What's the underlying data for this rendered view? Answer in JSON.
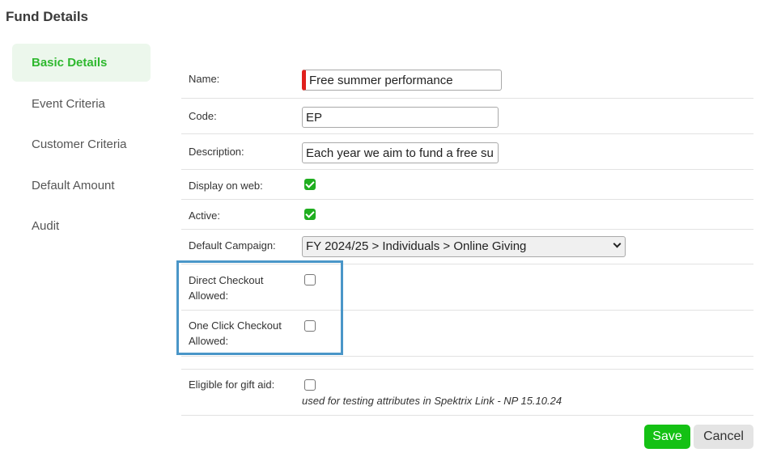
{
  "page_title": "Fund Details",
  "sidenav": {
    "items": [
      {
        "label": "Basic Details"
      },
      {
        "label": "Event Criteria"
      },
      {
        "label": "Customer Criteria"
      },
      {
        "label": "Default Amount"
      },
      {
        "label": "Audit"
      }
    ]
  },
  "form": {
    "name": {
      "label": "Name:",
      "value": "Free summer performance"
    },
    "code": {
      "label": "Code:",
      "value": "EP"
    },
    "description": {
      "label": "Description:",
      "value": "Each year we aim to fund a free su"
    },
    "display_on_web": {
      "label": "Display on web:",
      "checked": true
    },
    "active": {
      "label": "Active:",
      "checked": true
    },
    "default_campaign": {
      "label": "Default Campaign:",
      "value": "FY 2024/25 > Individuals > Online Giving"
    },
    "direct_checkout": {
      "label_line1": "Direct Checkout",
      "label_line2": "Allowed:",
      "checked": false
    },
    "one_click_checkout": {
      "label_line1": "One Click Checkout",
      "label_line2": "Allowed:",
      "checked": false
    },
    "gift_aid": {
      "label": "Eligible for gift aid:",
      "checked": false,
      "note": "used for testing attributes in Spektrix Link - NP 15.10.24"
    }
  },
  "buttons": {
    "save": "Save",
    "cancel": "Cancel"
  },
  "colors": {
    "accent_green": "#1fae1f",
    "save_button": "#14c114",
    "highlight_border": "#4a96c8",
    "required_marker": "#e0201c"
  }
}
